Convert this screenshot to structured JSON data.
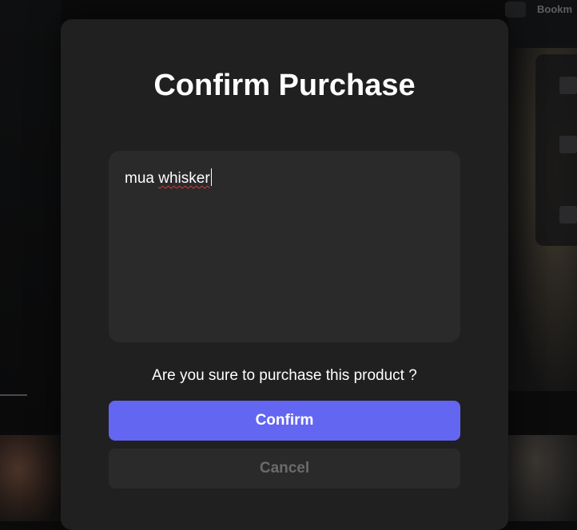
{
  "background": {
    "top_right_text": "Bookm",
    "colors": {
      "overlay": "#0b0b0c"
    }
  },
  "modal": {
    "title": "Confirm Purchase",
    "message": {
      "prefix": "mua ",
      "misspelled_word": "whisker"
    },
    "question": "Are you sure to purchase this product ?",
    "confirm_label": "Confirm",
    "cancel_label": "Cancel",
    "colors": {
      "surface": "#202020",
      "field": "#2a2a2a",
      "accent": "#6366f1",
      "muted_text": "#6b6b6e"
    }
  }
}
